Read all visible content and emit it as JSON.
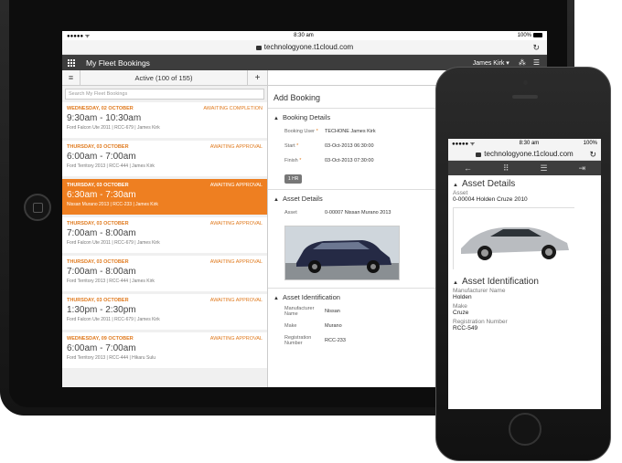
{
  "tablet": {
    "status": {
      "signal": "●●●●● ᯤ",
      "time": "8:30 am",
      "battery": "100%"
    },
    "url": "technologyone.t1cloud.com",
    "header": {
      "title": "My Fleet Bookings",
      "user": "James Kirk ▾"
    },
    "toolbar": {
      "filter": "Active (100 of 155)",
      "add": "+"
    },
    "search_placeholder": "Search My Fleet Bookings",
    "bookings": [
      {
        "date": "Wednesday, 02 October",
        "status": "AWAITING COMPLETION",
        "time": "9:30am - 10:30am",
        "vehicle": "Ford Falcon Ute 2011 | RCC-679 | James Kirk"
      },
      {
        "date": "Thursday, 03 October",
        "status": "AWAITING APPROVAL",
        "time": "6:00am - 7:00am",
        "vehicle": "Ford Territory 2013 | RCC-444 | James Kirk"
      },
      {
        "date": "Thursday, 03 October",
        "status": "AWAITING APPROVAL",
        "time": "6:30am - 7:30am",
        "vehicle": "Nissan Murano 2013 | RCC-233 | James Kirk"
      },
      {
        "date": "Thursday, 03 October",
        "status": "AWAITING APPROVAL",
        "time": "7:00am - 8:00am",
        "vehicle": "Ford Falcon Ute 2011 | RCC-679 | James Kirk"
      },
      {
        "date": "Thursday, 03 October",
        "status": "AWAITING APPROVAL",
        "time": "7:00am - 8:00am",
        "vehicle": "Ford Territory 2013 | RCC-444 | James Kirk"
      },
      {
        "date": "Thursday, 03 October",
        "status": "AWAITING APPROVAL",
        "time": "1:30pm - 2:30pm",
        "vehicle": "Ford Falcon Ute 2011 | RCC-679 | James Kirk"
      },
      {
        "date": "Wednesday, 09 October",
        "status": "AWAITING APPROVAL",
        "time": "6:00am - 7:00am",
        "vehicle": "Ford Territory 2013 | RCC-444 | Hikaru Sulu"
      }
    ],
    "detail": {
      "heading": "Add Booking",
      "booking_section": "Booking Details",
      "booking_user_label": "Booking User",
      "booking_user": "TECHONE  James Kirk",
      "start_label": "Start",
      "start": "03-Oct-2013 06:30:00",
      "finish_label": "Finish",
      "finish": "03-Oct-2013 07:30:00",
      "duration": "1 HR",
      "asset_section": "Asset Details",
      "asset_label": "Asset",
      "asset": "0-00007  Nissan Murano 2013",
      "ident_section": "Asset Identification",
      "manufacturer_label": "Manufacturer Name",
      "manufacturer": "Nissan",
      "make_label": "Make",
      "make": "Murano",
      "rego_label": "Registration Number",
      "rego": "RCC-233",
      "required_mark": "*"
    }
  },
  "phone": {
    "status": {
      "signal": "●●●●● ᯤ",
      "time": "8:30 am",
      "battery": "100%"
    },
    "url": "technologyone.t1cloud.com",
    "asset_section": "Asset Details",
    "asset_label": "Asset",
    "asset": "0-00004  Holden Cruze 2010",
    "ident_section": "Asset Identification",
    "manufacturer_label": "Manufacturer Name",
    "manufacturer": "Holden",
    "make_label": "Make",
    "make": "Cruze",
    "rego_label": "Registration Number",
    "rego": "RCC-549"
  },
  "colors": {
    "accent": "#ee7f21",
    "header": "#3d3d3d"
  }
}
